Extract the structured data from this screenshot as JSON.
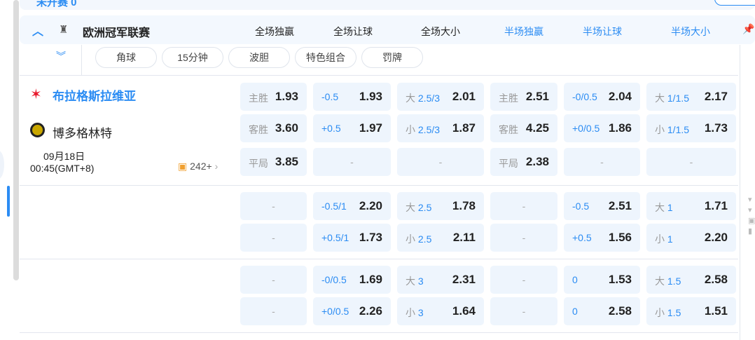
{
  "top_section": {
    "title": "未开赛 0"
  },
  "league": {
    "name": "欧洲冠军联赛",
    "collapse_icon": "chevron-up-icon",
    "logo_icon": "trophy-icon"
  },
  "columns": [
    "全场独赢",
    "全场让球",
    "全场大小",
    "半场独赢",
    "半场让球",
    "半场大小"
  ],
  "colors": {
    "accent": "#2b8cf3",
    "cell_bg": "#eef5fd"
  },
  "chips": [
    "角球",
    "15分钟",
    "波胆",
    "特色组合",
    "罚牌"
  ],
  "match": {
    "home": "布拉格斯拉维亚",
    "away": "博多格林特",
    "date": "09月18日",
    "time": "00:45(GMT+8)",
    "markets_count": "242+"
  },
  "rows": [
    [
      {
        "k": "主胜",
        "v": "1.93"
      },
      {
        "h": "-0.5",
        "v": "1.93"
      },
      {
        "k": "大",
        "h": "2.5/3",
        "v": "2.01"
      },
      {
        "k": "主胜",
        "v": "2.51"
      },
      {
        "h": "-0/0.5",
        "v": "2.04"
      },
      {
        "k": "大",
        "h": "1/1.5",
        "v": "2.17"
      }
    ],
    [
      {
        "k": "客胜",
        "v": "3.60"
      },
      {
        "h": "+0.5",
        "v": "1.97"
      },
      {
        "k": "小",
        "h": "2.5/3",
        "v": "1.87"
      },
      {
        "k": "客胜",
        "v": "4.25"
      },
      {
        "h": "+0/0.5",
        "v": "1.86"
      },
      {
        "k": "小",
        "h": "1/1.5",
        "v": "1.73"
      }
    ],
    [
      {
        "k": "平局",
        "v": "3.85"
      },
      {
        "d": "-"
      },
      {
        "d": "-"
      },
      {
        "k": "平局",
        "v": "2.38"
      },
      {
        "d": "-"
      },
      {
        "d": "-"
      }
    ],
    [
      {
        "d": "-"
      },
      {
        "h": "-0.5/1",
        "v": "2.20"
      },
      {
        "k": "大",
        "h": "2.5",
        "v": "1.78"
      },
      {
        "d": "-"
      },
      {
        "h": "-0.5",
        "v": "2.51"
      },
      {
        "k": "大",
        "h": "1",
        "v": "1.71"
      }
    ],
    [
      {
        "d": "-"
      },
      {
        "h": "+0.5/1",
        "v": "1.73"
      },
      {
        "k": "小",
        "h": "2.5",
        "v": "2.11"
      },
      {
        "d": "-"
      },
      {
        "h": "+0.5",
        "v": "1.56"
      },
      {
        "k": "小",
        "h": "1",
        "v": "2.20"
      }
    ],
    [
      {
        "d": "-"
      },
      {
        "h": "-0/0.5",
        "v": "1.69"
      },
      {
        "k": "大",
        "h": "3",
        "v": "2.31"
      },
      {
        "d": "-"
      },
      {
        "h": "0",
        "v": "1.53"
      },
      {
        "k": "大",
        "h": "1.5",
        "v": "2.58"
      }
    ],
    [
      {
        "d": "-"
      },
      {
        "h": "+0/0.5",
        "v": "2.26"
      },
      {
        "k": "小",
        "h": "3",
        "v": "1.64"
      },
      {
        "d": "-"
      },
      {
        "h": "0",
        "v": "2.58"
      },
      {
        "k": "小",
        "h": "1.5",
        "v": "1.51"
      }
    ]
  ]
}
